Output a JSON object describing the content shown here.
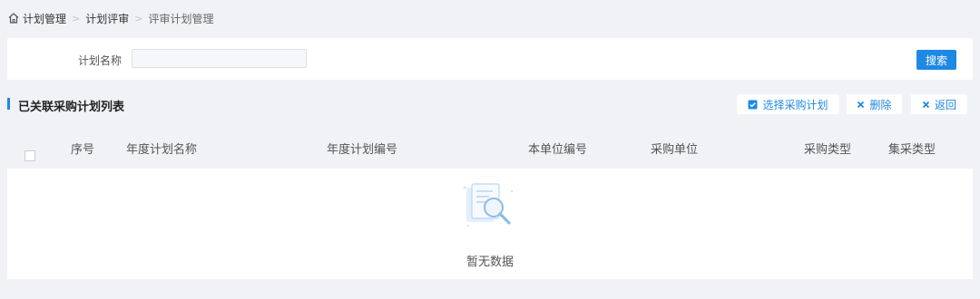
{
  "breadcrumb": {
    "items": [
      "计划管理",
      "计划评审",
      "评审计划管理"
    ]
  },
  "search": {
    "label": "计划名称",
    "value": "",
    "placeholder": "",
    "button": "搜索"
  },
  "list": {
    "title": "已关联采购计划列表",
    "buttons": {
      "select": "选择采购计划",
      "delete": "删除",
      "back": "返回"
    }
  },
  "table": {
    "columns": [
      "序号",
      "年度计划名称",
      "年度计划编号",
      "本单位编号",
      "采购单位",
      "采购类型",
      "集采类型"
    ],
    "rows": [],
    "empty_text": "暂无数据"
  },
  "colors": {
    "accent": "#1e88e5",
    "background": "#f0f2f5"
  },
  "icons": {
    "home": "home-icon",
    "select": "checkbox-checked-icon",
    "delete": "close-icon",
    "back": "close-icon",
    "empty": "document-search-icon"
  }
}
